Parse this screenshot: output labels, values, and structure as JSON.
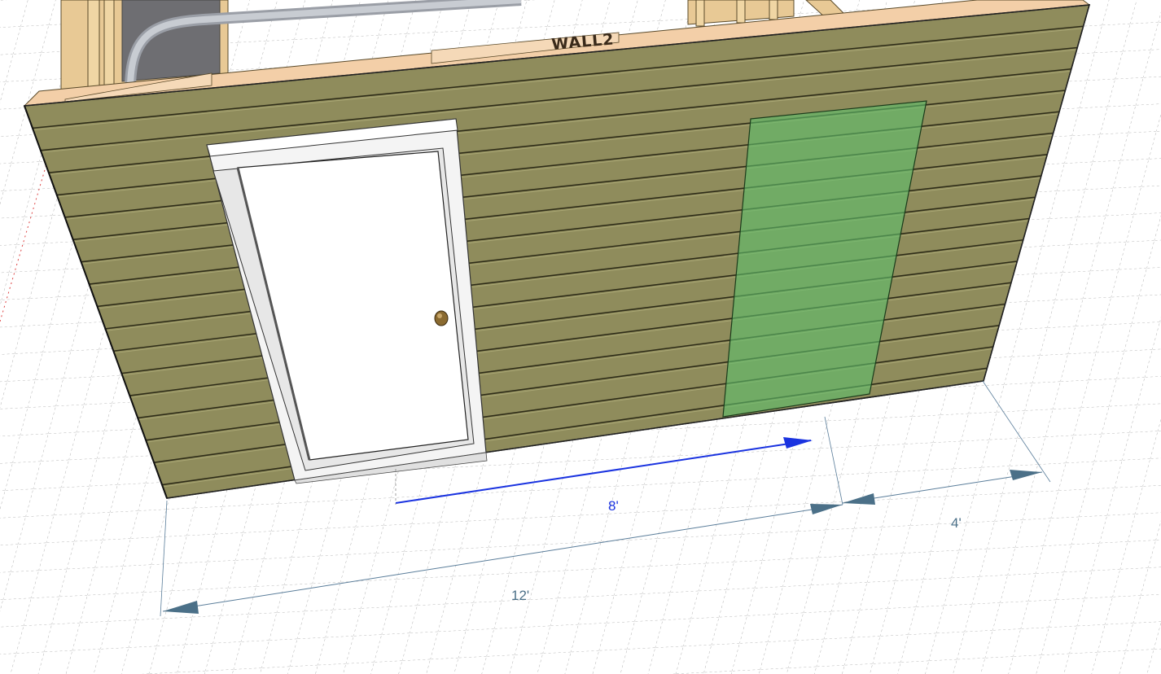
{
  "scene": {
    "wall_label": "WALL2",
    "colors": {
      "siding": "#8f8c5c",
      "siding_line": "#2e2c18",
      "door": "#ffffff",
      "trim": "#f4f4f4",
      "highlight": "#5fbf6a",
      "framing": "#e8c995",
      "dimension": "#5a7d9a",
      "active_dimension": "#1a33e0",
      "grid": "#9a9a9a"
    }
  },
  "dimensions": {
    "total": "12'",
    "active": "8'",
    "remaining": "4'"
  }
}
